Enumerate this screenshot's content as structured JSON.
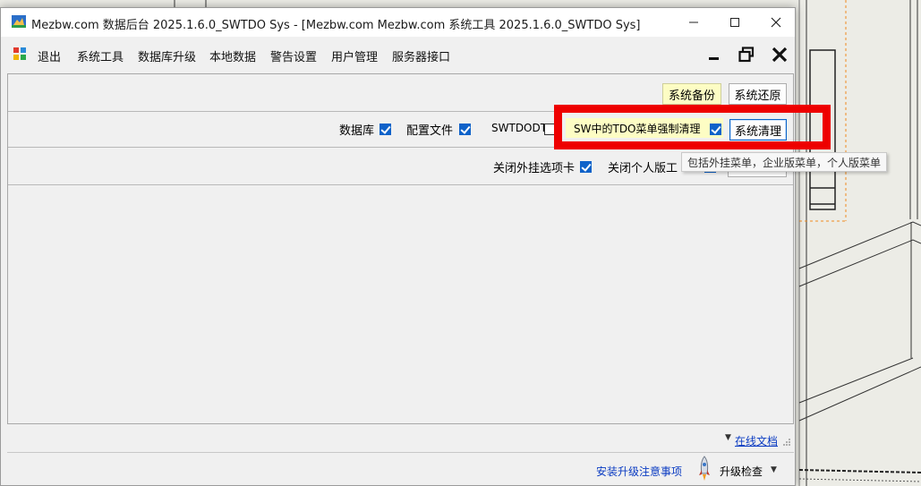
{
  "window": {
    "title": "Mezbw.com 数据后台 2025.1.6.0_SWTDO Sys - [Mezbw.com Mezbw.com 系统工具 2025.1.6.0_SWTDO Sys]",
    "minimize_glyph": "—",
    "maximize_glyph": "☐",
    "close_glyph": "✕"
  },
  "menubar": {
    "items": [
      "退出",
      "系统工具",
      "数据库升级",
      "本地数据",
      "警告设置",
      "用户管理",
      "服务器接口"
    ]
  },
  "toolbar": {
    "backup_label": "系统备份",
    "restore_label": "系统还原"
  },
  "options": {
    "database_label": "数据库",
    "database_checked": true,
    "config_label": "配置文件",
    "config_checked": true,
    "swtdodt_label": "SWTDODT",
    "swtdodt_checked": false,
    "tdo_menu_label": "SW中的TDO菜单强制清理",
    "tdo_menu_checked": true,
    "clean_label": "系统清理",
    "close_addin_tab_label": "关闭外挂选项卡",
    "close_addin_tab_checked": true,
    "close_personal_label": "关闭个人版工",
    "close_personal_checked": true
  },
  "tooltip": {
    "text": "包括外挂菜单，企业版菜单，个人版菜单"
  },
  "footer": {
    "online_docs_label": "在线文档",
    "install_notes_label": "安装升级注意事项",
    "upgrade_check_label": "升级检查"
  },
  "colors": {
    "highlight_red": "#ee0000",
    "yellow_button": "#fdfdc4",
    "checkbox_blue": "#0f62c9",
    "link_blue": "#0a3bc2"
  },
  "icons": [
    "app-icon",
    "menu-app-icon",
    "mdi-minimize-icon",
    "mdi-restore-icon",
    "mdi-close-icon",
    "rocket-icon",
    "dropdown-arrow-icon",
    "resize-grip-icon"
  ]
}
